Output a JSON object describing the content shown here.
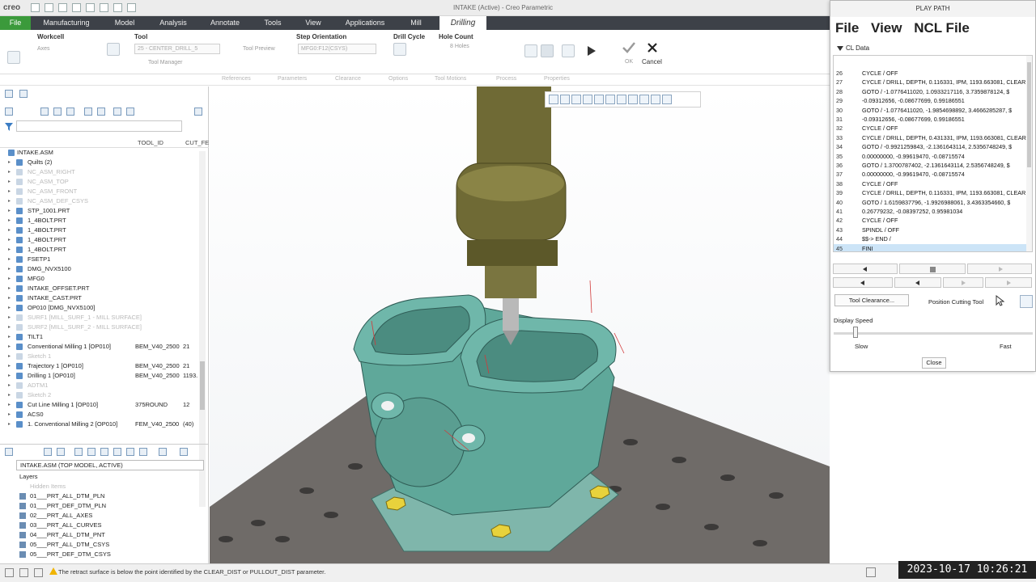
{
  "titlebar": {
    "logo": "creo",
    "title": "INTAKE (Active) - Creo Parametric"
  },
  "tabs": [
    {
      "label": "File"
    },
    {
      "label": "Manufacturing"
    },
    {
      "label": "Model"
    },
    {
      "label": "Analysis"
    },
    {
      "label": "Annotate"
    },
    {
      "label": "Tools"
    },
    {
      "label": "View"
    },
    {
      "label": "Applications"
    },
    {
      "label": "Mill"
    },
    {
      "label": "Drilling"
    }
  ],
  "ribbon": {
    "workcell": {
      "label": "Workcell",
      "value": "Axes"
    },
    "tool": {
      "label": "Tool",
      "value": "25 - CENTER_DRILL_5",
      "preview": "Tool Preview",
      "manager": "Tool Manager"
    },
    "step": {
      "label": "Step Orientation",
      "value": "MFG0:F12(CSYS)"
    },
    "drillcycle": {
      "label": "Drill Cycle"
    },
    "holecount": {
      "label": "Hole Count",
      "value": "8 Holes"
    },
    "ok_label": "OK",
    "cancel_label": "Cancel",
    "subtabs": [
      "References",
      "Parameters",
      "Clearance",
      "Options",
      "Tool Motions",
      "Process",
      "Properties"
    ]
  },
  "tree": {
    "columns": [
      "TOOL_ID",
      "CUT_FE"
    ],
    "rows": [
      {
        "name": "INTAKE.ASM",
        "c1": "",
        "c2": ""
      },
      {
        "name": "Quilts (2)",
        "c1": "",
        "c2": ""
      },
      {
        "name": "NC_ASM_RIGHT",
        "c1": "",
        "c2": ""
      },
      {
        "name": "NC_ASM_TOP",
        "c1": "",
        "c2": ""
      },
      {
        "name": "NC_ASM_FRONT",
        "c1": "",
        "c2": ""
      },
      {
        "name": "NC_ASM_DEF_CSYS",
        "c1": "",
        "c2": ""
      },
      {
        "name": "STP_1001.PRT",
        "c1": "",
        "c2": ""
      },
      {
        "name": "1_4BOLT.PRT",
        "c1": "",
        "c2": ""
      },
      {
        "name": "1_4BOLT.PRT",
        "c1": "",
        "c2": ""
      },
      {
        "name": "1_4BOLT.PRT",
        "c1": "",
        "c2": ""
      },
      {
        "name": "1_4BOLT.PRT",
        "c1": "",
        "c2": ""
      },
      {
        "name": "FSETP1",
        "c1": "",
        "c2": ""
      },
      {
        "name": "DMG_NVX5100",
        "c1": "",
        "c2": ""
      },
      {
        "name": "MFG0",
        "c1": "",
        "c2": ""
      },
      {
        "name": "INTAKE_OFFSET.PRT",
        "c1": "",
        "c2": ""
      },
      {
        "name": "INTAKE_CAST.PRT",
        "c1": "",
        "c2": ""
      },
      {
        "name": "OP010 [DMG_NVX5100]",
        "c1": "",
        "c2": ""
      },
      {
        "name": "SURF1 [MILL_SURF_1 - MILL SURFACE]",
        "c1": "",
        "c2": ""
      },
      {
        "name": "SURF2 [MILL_SURF_2 - MILL SURFACE]",
        "c1": "",
        "c2": ""
      },
      {
        "name": "TILT1",
        "c1": "",
        "c2": ""
      },
      {
        "name": "Conventional Milling 1 [OP010]",
        "c1": "BEM_V40_2500",
        "c2": "21"
      },
      {
        "name": "Sketch 1",
        "c1": "",
        "c2": ""
      },
      {
        "name": "Trajectory 1 [OP010]",
        "c1": "BEM_V40_2500",
        "c2": "21"
      },
      {
        "name": "Drilling 1 [OP010]",
        "c1": "BEM_V40_2500",
        "c2": "1193."
      },
      {
        "name": "ADTM1",
        "c1": "",
        "c2": ""
      },
      {
        "name": "Sketch 2",
        "c1": "",
        "c2": ""
      },
      {
        "name": "Cut Line Milling 1 [OP010]",
        "c1": "375ROUND",
        "c2": "12"
      },
      {
        "name": "ACS0",
        "c1": "",
        "c2": ""
      },
      {
        "name": "1. Conventional Milling 2 [OP010]",
        "c1": "FEM_V40_2500",
        "c2": "(40)"
      }
    ]
  },
  "layers": {
    "select_value": "INTAKE.ASM (TOP MODEL, ACTIVE)",
    "header": "Layers",
    "rows": [
      {
        "name": "Hidden Items"
      },
      {
        "name": "01___PRT_ALL_DTM_PLN"
      },
      {
        "name": "01___PRT_DEF_DTM_PLN"
      },
      {
        "name": "02___PRT_ALL_AXES"
      },
      {
        "name": "03___PRT_ALL_CURVES"
      },
      {
        "name": "04___PRT_ALL_DTM_PNT"
      },
      {
        "name": "05___PRT_ALL_DTM_CSYS"
      },
      {
        "name": "05___PRT_DEF_DTM_CSYS"
      }
    ]
  },
  "status": {
    "message": "The retract surface is below the point identified by the CLEAR_DIST or PULLOUT_DIST parameter.",
    "timestamp": "2023-10-17  10:26:21"
  },
  "playpath": {
    "title": "PLAY PATH",
    "menu": [
      "File",
      "View",
      "NCL File"
    ],
    "cl_label": "CL Data",
    "lines": [
      {
        "n": "26",
        "t": "CYCLE / OFF"
      },
      {
        "n": "27",
        "t": "CYCLE / DRILL, DEPTH, 0.116331, IPM, 1193.663081, CLEAR"
      },
      {
        "n": "28",
        "t": "GOTO / -1.0776411020, 1.0933217116, 3.7359878124,  $"
      },
      {
        "n": "29",
        "t": "-0.09312656, -0.08677699, 0.99186551"
      },
      {
        "n": "30",
        "t": "GOTO / -1.0776411020, -1.9854698892, 3.4666285287,  $"
      },
      {
        "n": "31",
        "t": "-0.09312656, -0.08677699, 0.99186551"
      },
      {
        "n": "32",
        "t": "CYCLE / OFF"
      },
      {
        "n": "33",
        "t": "CYCLE / DRILL, DEPTH, 0.431331, IPM, 1193.663081, CLEAR"
      },
      {
        "n": "34",
        "t": "GOTO / -0.9921259843, -2.1361643114, 2.5356748249,  $"
      },
      {
        "n": "35",
        "t": "0.00000000, -0.99619470, -0.08715574"
      },
      {
        "n": "36",
        "t": "GOTO / 1.3700787402, -2.1361643114, 2.5356748249,  $"
      },
      {
        "n": "37",
        "t": "0.00000000, -0.99619470, -0.08715574"
      },
      {
        "n": "38",
        "t": "CYCLE / OFF"
      },
      {
        "n": "39",
        "t": "CYCLE / DRILL, DEPTH, 0.116331, IPM, 1193.663081, CLEAR"
      },
      {
        "n": "40",
        "t": "GOTO / 1.6159837796, -1.9926988061, 3.4363354660,  $"
      },
      {
        "n": "41",
        "t": "0.26779232, -0.08397252, 0.95981034"
      },
      {
        "n": "42",
        "t": "CYCLE / OFF"
      },
      {
        "n": "43",
        "t": "SPINDL / OFF"
      },
      {
        "n": "44",
        "t": "$$-> END /"
      },
      {
        "n": "45",
        "t": "FINI"
      }
    ],
    "tool_clearance": "Tool Clearance...",
    "position_cutting_tool": "Position Cutting Tool",
    "display_speed": "Display Speed",
    "slow": "Slow",
    "fast": "Fast",
    "close": "Close"
  },
  "colors": {
    "ribbon_dark": "#3d4148",
    "file_tab": "#3b9a3b",
    "part_teal": "#5fa89a",
    "tool_olive": "#6f6a35",
    "table_gray": "#6f6b68",
    "bolt_yellow": "#e8d23c",
    "selection": "#cce4f7"
  }
}
